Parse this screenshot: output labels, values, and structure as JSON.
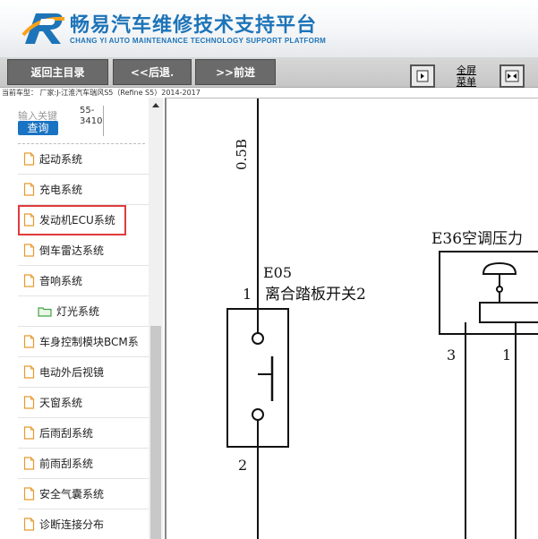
{
  "header": {
    "title": "畅易汽车维修技术支持平台",
    "subtitle": "CHANG YI AUTO MAINTENANCE TECHNOLOGY SUPPORT PLATFORM",
    "brand_color": "#1d74b8"
  },
  "toolbar": {
    "home_label": "返回主目录",
    "back_label": "<<后退.",
    "forward_label": ">>前进",
    "fullscreen_label_1": "全屏",
    "fullscreen_label_2": "菜单"
  },
  "model_line": "当前车型：  厂家:J-江淮汽车瑞风S5（Refine S5）2014-2017",
  "search": {
    "label": "输入关键",
    "button": "查询",
    "value": "55-3410"
  },
  "sidebar": {
    "items": [
      {
        "label": "起动系统",
        "icon": "document-icon"
      },
      {
        "label": "充电系统",
        "icon": "document-icon"
      },
      {
        "label": "发动机ECU系统",
        "icon": "document-icon",
        "active": true
      },
      {
        "label": "倒车雷达系统",
        "icon": "document-icon"
      },
      {
        "label": "音响系统",
        "icon": "document-icon"
      },
      {
        "label": "灯光系统",
        "icon": "folder-icon"
      },
      {
        "label": "车身控制模块BCM系",
        "icon": "document-icon"
      },
      {
        "label": "电动外后视镜",
        "icon": "document-icon"
      },
      {
        "label": "天窗系统",
        "icon": "document-icon"
      },
      {
        "label": "后雨刮系统",
        "icon": "document-icon"
      },
      {
        "label": "前雨刮系统",
        "icon": "document-icon"
      },
      {
        "label": "安全气囊系统",
        "icon": "document-icon"
      },
      {
        "label": "诊断连接分布",
        "icon": "document-icon"
      }
    ],
    "active_outline_color": "#e03b3b"
  },
  "diagram": {
    "wire_label": "0.5B",
    "switch_code": "E05",
    "switch_name": "离合踏板开关2",
    "pin_1": "1",
    "pin_2": "2",
    "sensor_label": "E36空调压力",
    "pin_3": "3",
    "pin_1b": "1"
  }
}
